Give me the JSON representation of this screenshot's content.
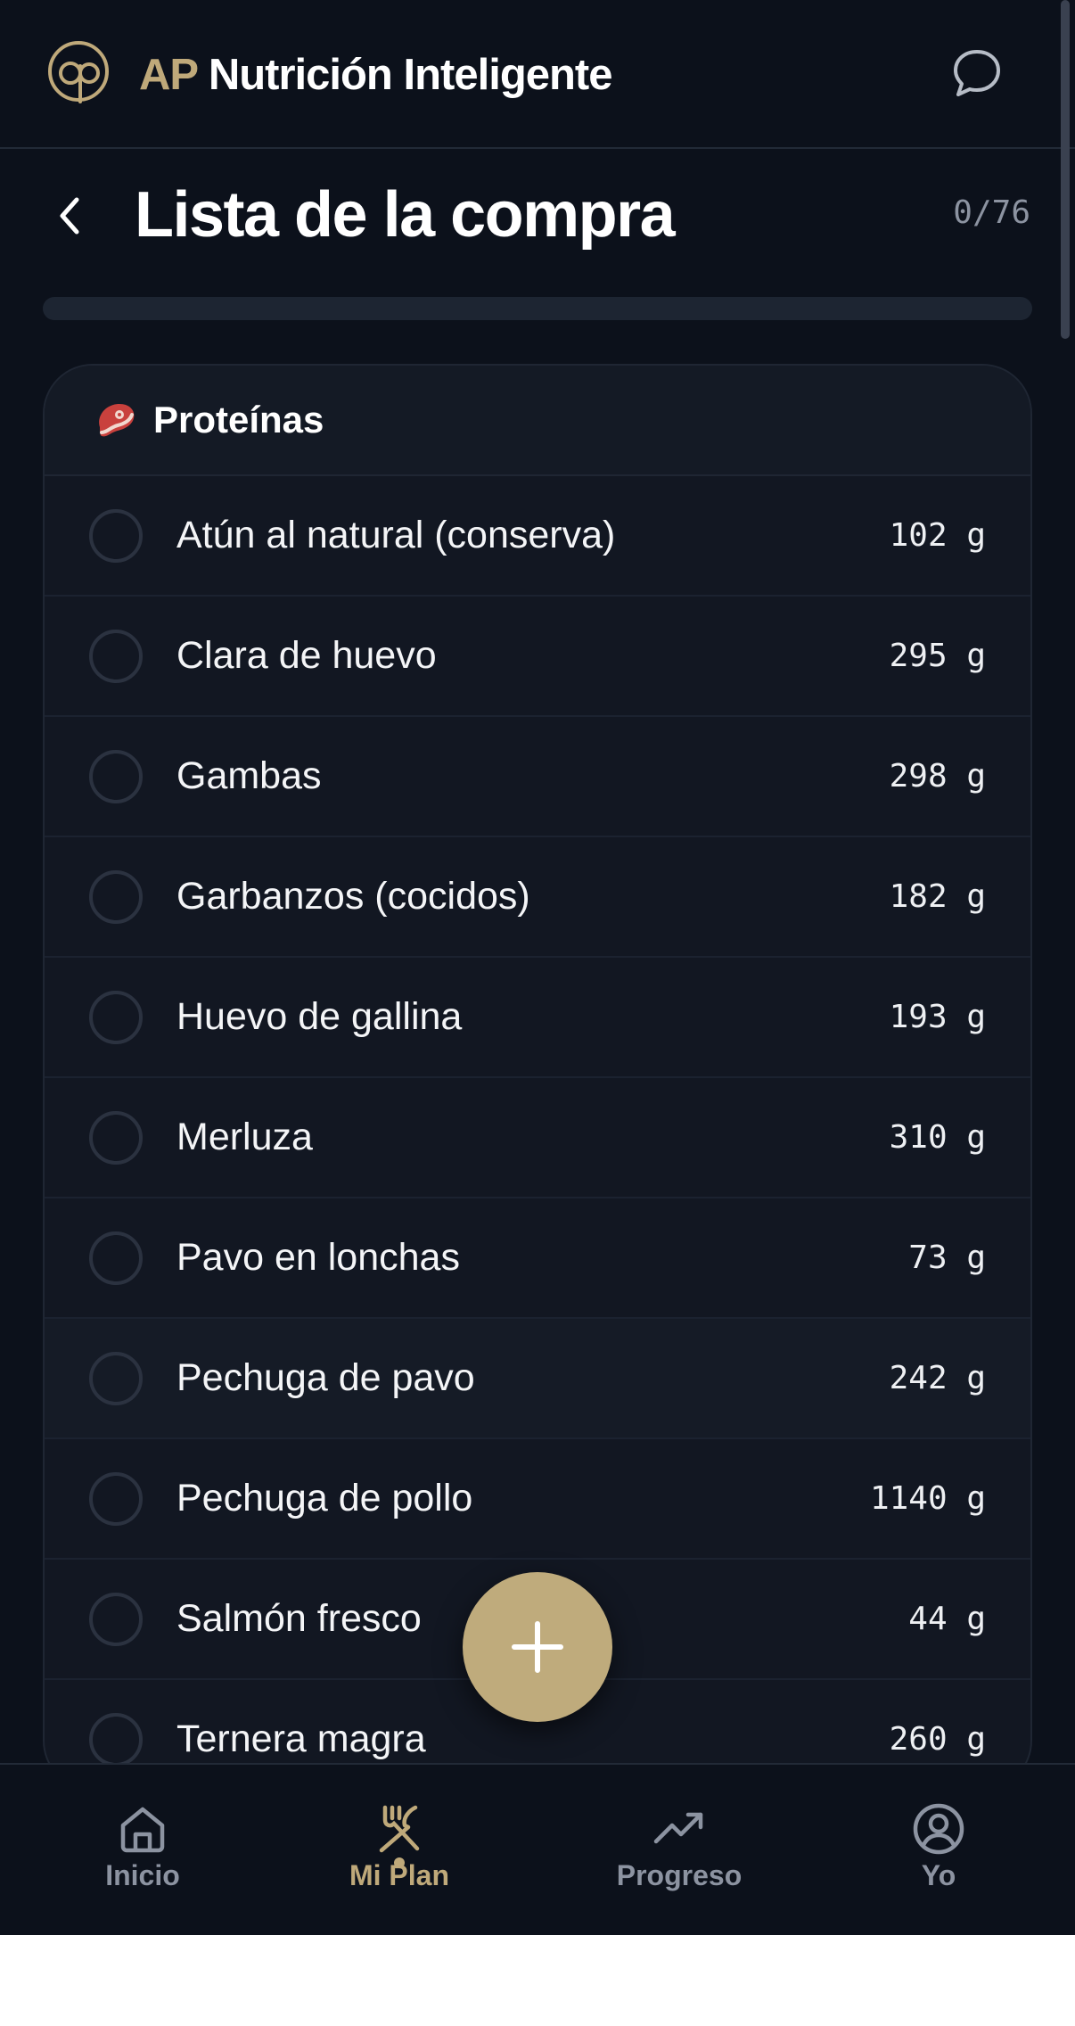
{
  "topbar": {
    "brand_prefix": "AP",
    "brand_name": "Nutrición Inteligente",
    "logo_icon": "ap-logo-icon",
    "chat_icon": "chat-bubble-icon"
  },
  "header": {
    "title": "Lista de la compra",
    "counter": "0/76",
    "progress": 0
  },
  "colors": {
    "background": "#0c111b",
    "card": "#121722",
    "accent": "#bfa97a",
    "muted": "#8c93a1"
  },
  "category": {
    "emoji": "🥩",
    "title": "Proteínas",
    "items": [
      {
        "name": "Atún al natural (conserva)",
        "qty": "102 g"
      },
      {
        "name": "Clara de huevo",
        "qty": "295 g"
      },
      {
        "name": "Gambas",
        "qty": "298 g"
      },
      {
        "name": "Garbanzos (cocidos)",
        "qty": "182 g"
      },
      {
        "name": "Huevo de gallina",
        "qty": "193 g"
      },
      {
        "name": "Merluza",
        "qty": "310 g"
      },
      {
        "name": "Pavo en lonchas",
        "qty": "73 g"
      },
      {
        "name": "Pechuga de pavo",
        "qty": "242 g"
      },
      {
        "name": "Pechuga de pollo",
        "qty": "1140 g"
      },
      {
        "name": "Salmón fresco",
        "qty": "44 g"
      },
      {
        "name": "Ternera magra",
        "qty": "260 g"
      }
    ]
  },
  "fab": {
    "icon": "plus-icon"
  },
  "nav": [
    {
      "label": "Inicio",
      "icon": "home-icon"
    },
    {
      "label": "Mi Plan",
      "icon": "fork-knife-icon"
    },
    {
      "label": "Progreso",
      "icon": "trending-up-icon"
    },
    {
      "label": "Yo",
      "icon": "user-circle-icon"
    }
  ]
}
